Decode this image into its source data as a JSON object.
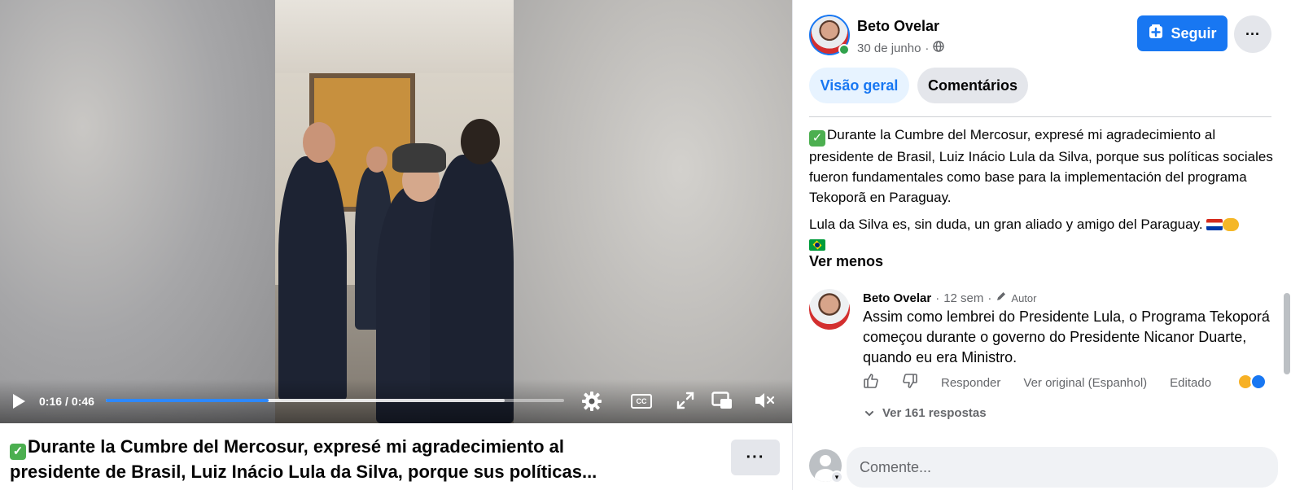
{
  "video": {
    "time_current": "0:16",
    "time_separator": "/",
    "time_total": "0:46",
    "progress_fraction": 0.356,
    "buffered_fraction": 0.87,
    "icons": [
      "play-icon",
      "settings-icon",
      "cc-icon",
      "fullscreen-icon",
      "picture-in-picture-icon",
      "muted-icon"
    ],
    "cc_label": "CC"
  },
  "caption": {
    "title_line1": "Durante la Cumbre del Mercosur, expresé mi agradecimiento al",
    "title_line2": "presidente de Brasil, Luiz Inácio Lula da Silva, porque sus políticas...",
    "more_label": "···"
  },
  "post": {
    "author": "Beto Ovelar",
    "date": "30 de junho",
    "date_separator": "·",
    "privacy_icon": "globe-icon",
    "follow_label": "Seguir",
    "more_label": "···",
    "tabs": [
      {
        "label": "Visão geral",
        "active": true
      },
      {
        "label": "Comentários",
        "active": false
      }
    ],
    "paragraph1": "Durante la Cumbre del Mercosur, expresé mi agradecimiento al presidente de Brasil, Luiz Inácio Lula da Silva, porque sus políticas sociales fueron fundamentales como base para la implementación del programa Tekoporã en Paraguay.",
    "paragraph2": "Lula da Silva es, sin duda, un gran aliado y amigo del Paraguay.",
    "see_less": "Ver menos"
  },
  "comment": {
    "author": "Beto Ovelar",
    "time": "12 sem",
    "separator": "·",
    "badge": "Autor",
    "body": "Assim como lembrei do Presidente Lula, o Programa Tekoporá começou durante o governo do Presidente Nicanor Duarte, quando eu era Ministro.",
    "actions": {
      "reply": "Responder",
      "see_original": "Ver original (Espanhol)",
      "edited": "Editado"
    },
    "view_replies": "Ver 161 respostas"
  },
  "composer": {
    "placeholder": "Comente..."
  },
  "colors": {
    "accent": "#1877f2",
    "accent_light": "#e7f3ff",
    "secondary_bg": "#e4e6eb",
    "muted_text": "#65676b",
    "progress": "#2d88ff",
    "online": "#31a24c"
  }
}
